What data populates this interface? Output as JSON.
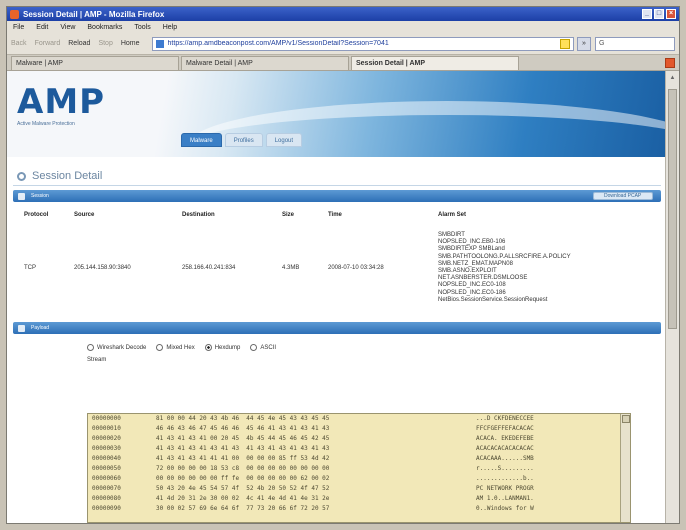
{
  "window": {
    "title": "Session Detail | AMP - Mozilla Firefox",
    "controls": [
      "_",
      "□",
      "×"
    ]
  },
  "menu": [
    "File",
    "Edit",
    "View",
    "Bookmarks",
    "Tools",
    "Help"
  ],
  "navbar": {
    "back": "Back",
    "forward": "Forward",
    "reload": "Reload",
    "stop": "Stop",
    "home": "Home",
    "url": "https://amp.amdbeaconpost.com/AMP/v1/SessionDetail?Session=7041",
    "go": "»",
    "search_placeholder": "G"
  },
  "browser_tabs": [
    "Malware | AMP",
    "Malware Detail | AMP",
    "Session Detail | AMP"
  ],
  "logo": {
    "text": "AMP",
    "tagline": "Active Malware Protection"
  },
  "app_tabs": [
    "Malware",
    "Profiles",
    "Logout"
  ],
  "page_title": "Session Detail",
  "session_panel": {
    "label": "Session",
    "action": "Download PCAP",
    "columns": [
      "Protocol",
      "Source",
      "Destination",
      "Size",
      "Time",
      "Alarm Set"
    ],
    "row": {
      "protocol": "TCP",
      "source": "205.144.158.90:3840",
      "destination": "258.166.40.241:834",
      "size": "4.3MB",
      "time": "2008-07-10 03:34:28",
      "alarms": [
        "SMBDIRT",
        "NOPSLED_INC.EB0-106",
        "SMBDIRTEXP SMBLand",
        "SMB.PATHTOOLONG.P.ALLSRCFIRE.A.POLICY",
        "SMB.NETZ_EMAT.MAPN08",
        "SMB.ASNO.EXPLOIT",
        "NET.ASNBERSTER.DSMLOOSE",
        "NOPSLED_INC.EC0-108",
        "NOPSLED_INC.EC0-186",
        "NetBios.SessionService.SessionRequest"
      ]
    }
  },
  "payload_panel": {
    "label": "Payload",
    "options": [
      {
        "label": "Wireshark Decode",
        "selected": false
      },
      {
        "label": "Mixed Hex",
        "selected": false
      },
      {
        "label": "Hexdump",
        "selected": true
      },
      {
        "label": "ASCII",
        "selected": false
      }
    ],
    "stream_label": "Stream",
    "dump": [
      {
        "offset": "00000000",
        "hex": "81 00 00 44 20 43 4b 46  44 45 4e 45 43 43 45 45",
        "ascii": "...D CKFDENECCEE"
      },
      {
        "offset": "00000010",
        "hex": "46 46 43 46 47 45 46 46  45 46 41 43 41 43 41 43",
        "ascii": "FFCFGEFFEFACACAC"
      },
      {
        "offset": "00000020",
        "hex": "41 43 41 43 41 00 20 45  4b 45 44 45 46 45 42 45",
        "ascii": "ACACA. EKEDEFEBE"
      },
      {
        "offset": "00000030",
        "hex": "41 43 41 43 41 43 41 43  41 43 41 43 41 43 41 43",
        "ascii": "ACACACACACACACAC"
      },
      {
        "offset": "00000040",
        "hex": "41 43 41 43 41 41 41 00  00 00 00 85 ff 53 4d 42",
        "ascii": "ACACAAA......SMB"
      },
      {
        "offset": "00000050",
        "hex": "72 00 00 00 00 18 53 c8  00 00 00 00 00 00 00 00",
        "ascii": "r.....S........."
      },
      {
        "offset": "00000060",
        "hex": "00 00 00 00 00 00 ff fe  00 00 00 00 00 62 00 02",
        "ascii": ".............b.."
      },
      {
        "offset": "00000070",
        "hex": "50 43 20 4e 45 54 57 4f  52 4b 20 50 52 4f 47 52",
        "ascii": "PC NETWORK PROGR"
      },
      {
        "offset": "00000080",
        "hex": "41 4d 20 31 2e 30 00 02  4c 41 4e 4d 41 4e 31 2e",
        "ascii": "AM 1.0..LANMAN1."
      },
      {
        "offset": "00000090",
        "hex": "30 00 02 57 69 6e 64 6f  77 73 20 66 6f 72 20 57",
        "ascii": "0..Windows for W"
      }
    ]
  }
}
